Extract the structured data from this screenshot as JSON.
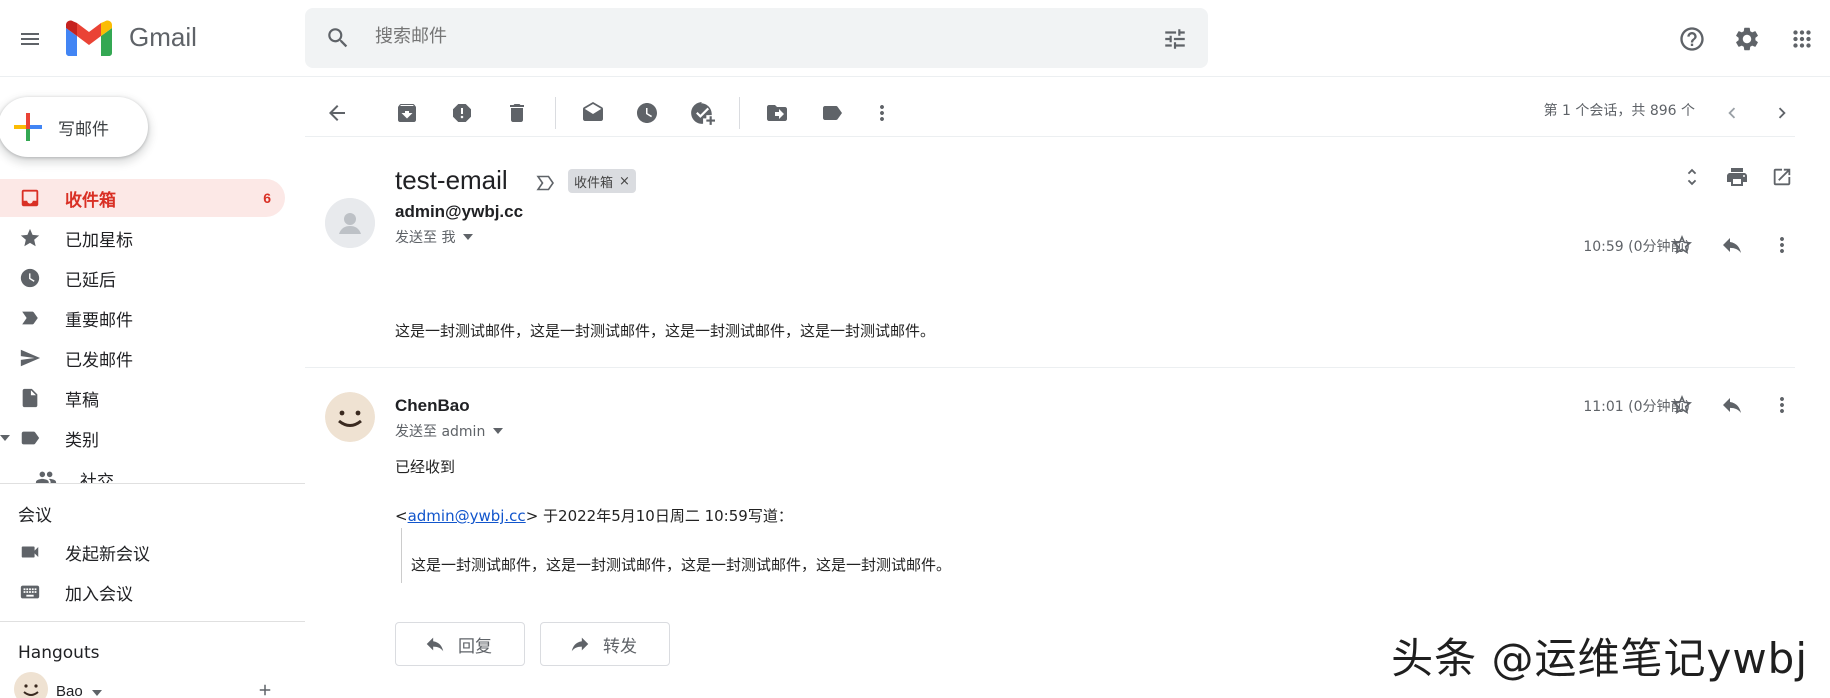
{
  "app": {
    "name": "Gmail"
  },
  "search": {
    "placeholder": "搜索邮件"
  },
  "compose": {
    "label": "写邮件"
  },
  "sidebar": {
    "items": [
      {
        "label": "收件箱",
        "count": "6"
      },
      {
        "label": "已加星标"
      },
      {
        "label": "已延后"
      },
      {
        "label": "重要邮件"
      },
      {
        "label": "已发邮件"
      },
      {
        "label": "草稿"
      },
      {
        "label": "类别"
      },
      {
        "label": "社交"
      }
    ],
    "meet": {
      "title": "会议",
      "new_meeting": "发起新会议",
      "join_meeting": "加入会议"
    },
    "hangouts": {
      "title": "Hangouts",
      "user": "Bao"
    }
  },
  "toolbar": {
    "pager": "第 1 个会话，共 896 个"
  },
  "thread": {
    "subject": "test-email",
    "label_chip": "收件箱",
    "label_chip_close": "×",
    "messages": [
      {
        "sender": "admin@ywbj.cc",
        "to": "发送至 我",
        "time": "10:59 (0分钟前)",
        "body": "这是一封测试邮件，这是一封测试邮件，这是一封测试邮件，这是一封测试邮件。"
      },
      {
        "sender": "ChenBao",
        "to": "发送至 admin",
        "time": "11:01 (0分钟前)",
        "body": "已经收到",
        "quote_prefix": "<",
        "quote_link": "admin@ywbj.cc",
        "quote_suffix": "> 于2022年5月10日周二 10:59写道：",
        "quote_body": "这是一封测试邮件，这是一封测试邮件，这是一封测试邮件，这是一封测试邮件。"
      }
    ]
  },
  "actions": {
    "reply": "回复",
    "forward": "转发"
  },
  "watermark": "头条 @运维笔记ywbj",
  "colors": {
    "accent": "#d93025",
    "active_bg": "#fce8e6",
    "icon": "#5f6368",
    "link": "#1155cc"
  }
}
